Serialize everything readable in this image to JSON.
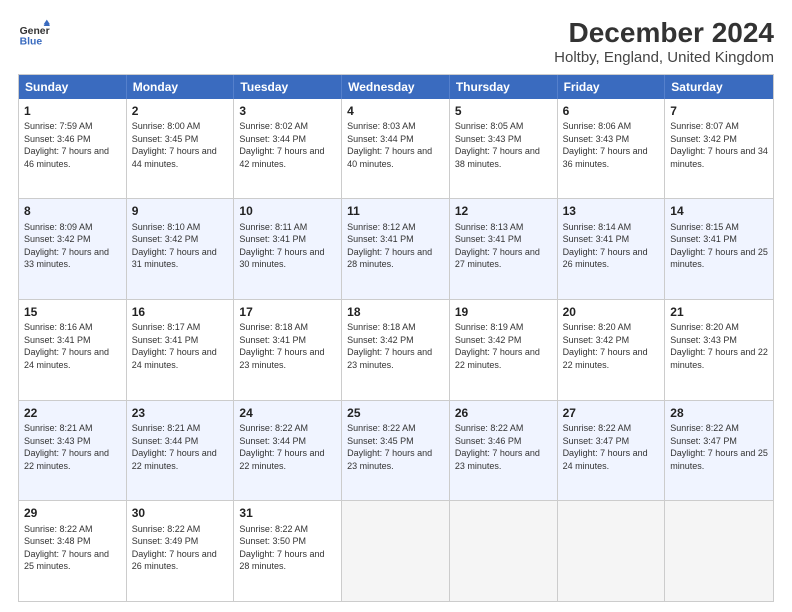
{
  "logo": {
    "line1": "General",
    "line2": "Blue"
  },
  "title": "December 2024",
  "subtitle": "Holtby, England, United Kingdom",
  "header_days": [
    "Sunday",
    "Monday",
    "Tuesday",
    "Wednesday",
    "Thursday",
    "Friday",
    "Saturday"
  ],
  "weeks": [
    [
      {
        "day": "1",
        "sunrise": "Sunrise: 7:59 AM",
        "sunset": "Sunset: 3:46 PM",
        "daylight": "Daylight: 7 hours and 46 minutes."
      },
      {
        "day": "2",
        "sunrise": "Sunrise: 8:00 AM",
        "sunset": "Sunset: 3:45 PM",
        "daylight": "Daylight: 7 hours and 44 minutes."
      },
      {
        "day": "3",
        "sunrise": "Sunrise: 8:02 AM",
        "sunset": "Sunset: 3:44 PM",
        "daylight": "Daylight: 7 hours and 42 minutes."
      },
      {
        "day": "4",
        "sunrise": "Sunrise: 8:03 AM",
        "sunset": "Sunset: 3:44 PM",
        "daylight": "Daylight: 7 hours and 40 minutes."
      },
      {
        "day": "5",
        "sunrise": "Sunrise: 8:05 AM",
        "sunset": "Sunset: 3:43 PM",
        "daylight": "Daylight: 7 hours and 38 minutes."
      },
      {
        "day": "6",
        "sunrise": "Sunrise: 8:06 AM",
        "sunset": "Sunset: 3:43 PM",
        "daylight": "Daylight: 7 hours and 36 minutes."
      },
      {
        "day": "7",
        "sunrise": "Sunrise: 8:07 AM",
        "sunset": "Sunset: 3:42 PM",
        "daylight": "Daylight: 7 hours and 34 minutes."
      }
    ],
    [
      {
        "day": "8",
        "sunrise": "Sunrise: 8:09 AM",
        "sunset": "Sunset: 3:42 PM",
        "daylight": "Daylight: 7 hours and 33 minutes."
      },
      {
        "day": "9",
        "sunrise": "Sunrise: 8:10 AM",
        "sunset": "Sunset: 3:42 PM",
        "daylight": "Daylight: 7 hours and 31 minutes."
      },
      {
        "day": "10",
        "sunrise": "Sunrise: 8:11 AM",
        "sunset": "Sunset: 3:41 PM",
        "daylight": "Daylight: 7 hours and 30 minutes."
      },
      {
        "day": "11",
        "sunrise": "Sunrise: 8:12 AM",
        "sunset": "Sunset: 3:41 PM",
        "daylight": "Daylight: 7 hours and 28 minutes."
      },
      {
        "day": "12",
        "sunrise": "Sunrise: 8:13 AM",
        "sunset": "Sunset: 3:41 PM",
        "daylight": "Daylight: 7 hours and 27 minutes."
      },
      {
        "day": "13",
        "sunrise": "Sunrise: 8:14 AM",
        "sunset": "Sunset: 3:41 PM",
        "daylight": "Daylight: 7 hours and 26 minutes."
      },
      {
        "day": "14",
        "sunrise": "Sunrise: 8:15 AM",
        "sunset": "Sunset: 3:41 PM",
        "daylight": "Daylight: 7 hours and 25 minutes."
      }
    ],
    [
      {
        "day": "15",
        "sunrise": "Sunrise: 8:16 AM",
        "sunset": "Sunset: 3:41 PM",
        "daylight": "Daylight: 7 hours and 24 minutes."
      },
      {
        "day": "16",
        "sunrise": "Sunrise: 8:17 AM",
        "sunset": "Sunset: 3:41 PM",
        "daylight": "Daylight: 7 hours and 24 minutes."
      },
      {
        "day": "17",
        "sunrise": "Sunrise: 8:18 AM",
        "sunset": "Sunset: 3:41 PM",
        "daylight": "Daylight: 7 hours and 23 minutes."
      },
      {
        "day": "18",
        "sunrise": "Sunrise: 8:18 AM",
        "sunset": "Sunset: 3:42 PM",
        "daylight": "Daylight: 7 hours and 23 minutes."
      },
      {
        "day": "19",
        "sunrise": "Sunrise: 8:19 AM",
        "sunset": "Sunset: 3:42 PM",
        "daylight": "Daylight: 7 hours and 22 minutes."
      },
      {
        "day": "20",
        "sunrise": "Sunrise: 8:20 AM",
        "sunset": "Sunset: 3:42 PM",
        "daylight": "Daylight: 7 hours and 22 minutes."
      },
      {
        "day": "21",
        "sunrise": "Sunrise: 8:20 AM",
        "sunset": "Sunset: 3:43 PM",
        "daylight": "Daylight: 7 hours and 22 minutes."
      }
    ],
    [
      {
        "day": "22",
        "sunrise": "Sunrise: 8:21 AM",
        "sunset": "Sunset: 3:43 PM",
        "daylight": "Daylight: 7 hours and 22 minutes."
      },
      {
        "day": "23",
        "sunrise": "Sunrise: 8:21 AM",
        "sunset": "Sunset: 3:44 PM",
        "daylight": "Daylight: 7 hours and 22 minutes."
      },
      {
        "day": "24",
        "sunrise": "Sunrise: 8:22 AM",
        "sunset": "Sunset: 3:44 PM",
        "daylight": "Daylight: 7 hours and 22 minutes."
      },
      {
        "day": "25",
        "sunrise": "Sunrise: 8:22 AM",
        "sunset": "Sunset: 3:45 PM",
        "daylight": "Daylight: 7 hours and 23 minutes."
      },
      {
        "day": "26",
        "sunrise": "Sunrise: 8:22 AM",
        "sunset": "Sunset: 3:46 PM",
        "daylight": "Daylight: 7 hours and 23 minutes."
      },
      {
        "day": "27",
        "sunrise": "Sunrise: 8:22 AM",
        "sunset": "Sunset: 3:47 PM",
        "daylight": "Daylight: 7 hours and 24 minutes."
      },
      {
        "day": "28",
        "sunrise": "Sunrise: 8:22 AM",
        "sunset": "Sunset: 3:47 PM",
        "daylight": "Daylight: 7 hours and 25 minutes."
      }
    ],
    [
      {
        "day": "29",
        "sunrise": "Sunrise: 8:22 AM",
        "sunset": "Sunset: 3:48 PM",
        "daylight": "Daylight: 7 hours and 25 minutes."
      },
      {
        "day": "30",
        "sunrise": "Sunrise: 8:22 AM",
        "sunset": "Sunset: 3:49 PM",
        "daylight": "Daylight: 7 hours and 26 minutes."
      },
      {
        "day": "31",
        "sunrise": "Sunrise: 8:22 AM",
        "sunset": "Sunset: 3:50 PM",
        "daylight": "Daylight: 7 hours and 28 minutes."
      },
      null,
      null,
      null,
      null
    ]
  ]
}
